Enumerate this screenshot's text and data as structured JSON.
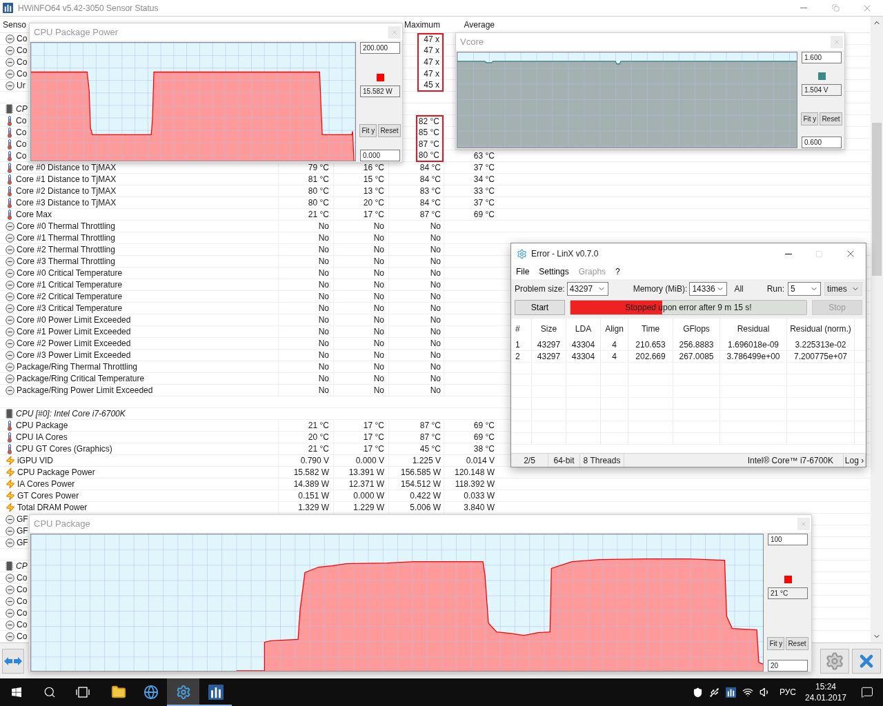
{
  "window": {
    "title": "HWiNFO64 v5.42-3050 Sensor Status"
  },
  "columns": {
    "sensor": "Senso",
    "maximum": "Maximum",
    "average": "Average"
  },
  "sections": [
    {
      "rows": [
        {
          "kind": "clock",
          "label": "Co",
          "maximum": "47 x",
          "boxed": true
        },
        {
          "kind": "clock",
          "label": "Co",
          "maximum": "47 x",
          "boxed": true
        },
        {
          "kind": "clock",
          "label": "Co",
          "maximum": "47 x",
          "boxed": true
        },
        {
          "kind": "clock",
          "label": "Co",
          "maximum": "47 x",
          "boxed": true
        },
        {
          "kind": "clock",
          "label": "Ur",
          "maximum": "45 x",
          "boxed": true
        }
      ]
    },
    {
      "header": "CP",
      "rows": [
        {
          "kind": "temperature",
          "label": "Co",
          "maximum": "82 °C",
          "boxed": true
        },
        {
          "kind": "temperature",
          "label": "Co",
          "maximum": "85 °C",
          "boxed": true
        },
        {
          "kind": "temperature",
          "label": "Co",
          "maximum": "87 °C",
          "boxed": true
        },
        {
          "kind": "temperature",
          "label": "Co",
          "maximum": "80 °C",
          "average": "63 °C",
          "boxed": true
        },
        {
          "kind": "temperature",
          "label": "Core #0 Distance to TjMAX",
          "current": "79 °C",
          "minimum": "16 °C",
          "maximum": "84 °C",
          "average": "37 °C",
          "boxed": false
        },
        {
          "kind": "temperature",
          "label": "Core #1 Distance to TjMAX",
          "current": "81 °C",
          "minimum": "15 °C",
          "maximum": "84 °C",
          "average": "34 °C",
          "boxed": false
        },
        {
          "kind": "temperature",
          "label": "Core #2 Distance to TjMAX",
          "current": "80 °C",
          "minimum": "13 °C",
          "maximum": "83 °C",
          "average": "33 °C",
          "boxed": false
        },
        {
          "kind": "temperature",
          "label": "Core #3 Distance to TjMAX",
          "current": "80 °C",
          "minimum": "20 °C",
          "maximum": "84 °C",
          "average": "37 °C",
          "boxed": false
        },
        {
          "kind": "temperature",
          "label": "Core Max",
          "current": "21 °C",
          "minimum": "17 °C",
          "maximum": "87 °C",
          "average": "69 °C",
          "boxed": false
        },
        {
          "kind": "clock",
          "label": "Core #0 Thermal Throttling",
          "current": "No",
          "minimum": "No",
          "maximum": "No",
          "boxed": false
        },
        {
          "kind": "clock",
          "label": "Core #1 Thermal Throttling",
          "current": "No",
          "minimum": "No",
          "maximum": "No",
          "boxed": false
        },
        {
          "kind": "clock",
          "label": "Core #2 Thermal Throttling",
          "current": "No",
          "minimum": "No",
          "maximum": "No",
          "boxed": false
        },
        {
          "kind": "clock",
          "label": "Core #3 Thermal Throttling",
          "current": "No",
          "minimum": "No",
          "maximum": "No",
          "boxed": false
        },
        {
          "kind": "clock",
          "label": "Core #0 Critical Temperature",
          "current": "No",
          "minimum": "No",
          "maximum": "No",
          "boxed": false
        },
        {
          "kind": "clock",
          "label": "Core #1 Critical Temperature",
          "current": "No",
          "minimum": "No",
          "maximum": "No",
          "boxed": false
        },
        {
          "kind": "clock",
          "label": "Core #2 Critical Temperature",
          "current": "No",
          "minimum": "No",
          "maximum": "No",
          "boxed": false
        },
        {
          "kind": "clock",
          "label": "Core #3 Critical Temperature",
          "current": "No",
          "minimum": "No",
          "maximum": "No",
          "boxed": false
        },
        {
          "kind": "clock",
          "label": "Core #0 Power Limit Exceeded",
          "current": "No",
          "minimum": "No",
          "maximum": "No",
          "boxed": false
        },
        {
          "kind": "clock",
          "label": "Core #1 Power Limit Exceeded",
          "current": "No",
          "minimum": "No",
          "maximum": "No",
          "boxed": false
        },
        {
          "kind": "clock",
          "label": "Core #2 Power Limit Exceeded",
          "current": "No",
          "minimum": "No",
          "maximum": "No",
          "boxed": false
        },
        {
          "kind": "clock",
          "label": "Core #3 Power Limit Exceeded",
          "current": "No",
          "minimum": "No",
          "maximum": "No",
          "boxed": false
        },
        {
          "kind": "clock",
          "label": "Package/Ring Thermal Throttling",
          "current": "No",
          "minimum": "No",
          "maximum": "No",
          "boxed": false
        },
        {
          "kind": "clock",
          "label": "Package/Ring Critical Temperature",
          "current": "No",
          "minimum": "No",
          "maximum": "No",
          "boxed": false
        },
        {
          "kind": "clock",
          "label": "Package/Ring Power Limit Exceeded",
          "current": "No",
          "minimum": "No",
          "maximum": "No",
          "boxed": false
        }
      ]
    },
    {
      "header": "CPU [#0]: Intel Core i7-6700K",
      "rows": [
        {
          "kind": "temperature",
          "label": "CPU Package",
          "current": "21 °C",
          "minimum": "17 °C",
          "maximum": "87 °C",
          "average": "69 °C",
          "boxed": false
        },
        {
          "kind": "temperature",
          "label": "CPU IA Cores",
          "current": "20 °C",
          "minimum": "17 °C",
          "maximum": "87 °C",
          "average": "69 °C",
          "boxed": false
        },
        {
          "kind": "temperature",
          "label": "CPU GT Cores (Graphics)",
          "current": "21 °C",
          "minimum": "17 °C",
          "maximum": "45 °C",
          "average": "38 °C",
          "boxed": false
        },
        {
          "kind": "power",
          "label": "iGPU VID",
          "current": "0.790 V",
          "minimum": "0.000 V",
          "maximum": "1.225 V",
          "average": "0.014 V",
          "boxed": false
        },
        {
          "kind": "power",
          "label": "CPU Package Power",
          "current": "15.582 W",
          "minimum": "13.391 W",
          "maximum": "156.585 W",
          "average": "120.148 W",
          "boxed": false
        },
        {
          "kind": "power",
          "label": "IA Cores Power",
          "current": "14.389 W",
          "minimum": "12.371 W",
          "maximum": "154.512 W",
          "average": "118.392 W",
          "boxed": false
        },
        {
          "kind": "power",
          "label": "GT Cores Power",
          "current": "0.151 W",
          "minimum": "0.000 W",
          "maximum": "0.422 W",
          "average": "0.033 W",
          "boxed": false
        },
        {
          "kind": "power",
          "label": "Total DRAM Power",
          "current": "1.329 W",
          "minimum": "1.229 W",
          "maximum": "5.006 W",
          "average": "3.840 W",
          "boxed": false
        },
        {
          "kind": "clock",
          "label": "GF"
        },
        {
          "kind": "clock",
          "label": "GF"
        },
        {
          "kind": "clock",
          "label": "GF"
        }
      ]
    },
    {
      "header": "CP",
      "rows": [
        {
          "kind": "clock",
          "label": "Co"
        },
        {
          "kind": "clock",
          "label": "Co"
        },
        {
          "kind": "clock",
          "label": "Co"
        },
        {
          "kind": "clock",
          "label": "Co"
        },
        {
          "kind": "clock",
          "label": "Co"
        },
        {
          "kind": "clock",
          "label": "Co"
        }
      ]
    }
  ],
  "graphs": [
    {
      "kind": "power",
      "title": "CPU Package Power",
      "top_value": "200.000",
      "current": "15.582 W",
      "bottom_value": "0.000",
      "color": "#ff0000",
      "buttons": [
        "Fit y",
        "Reset"
      ]
    },
    {
      "kind": "voltage",
      "title": "Vcore",
      "top_value": "1.600",
      "current": "1.504 V",
      "bottom_value": "0.600",
      "color": "#3a8a8a",
      "buttons": [
        "Fit y",
        "Reset"
      ]
    },
    {
      "kind": "temperature",
      "title": "CPU Package",
      "top_value": "100",
      "current": "21 °C",
      "bottom_value": "20",
      "color": "#ff0000",
      "buttons": [
        "Fit y",
        "Reset"
      ]
    }
  ],
  "linx": {
    "title": "Error - LinX v0.7.0",
    "menu": [
      {
        "label": "File",
        "disabled": false
      },
      {
        "label": "Settings",
        "disabled": false
      },
      {
        "label": "Graphs",
        "disabled": true
      },
      {
        "label": "?",
        "disabled": false
      }
    ],
    "problem_size": {
      "label": "Problem size:",
      "value": "43297"
    },
    "memory": {
      "label": "Memory (MiB):",
      "value": "14336"
    },
    "all": "All",
    "run": {
      "label": "Run:",
      "value": "5",
      "unit": "times"
    },
    "start": {
      "label": "Start",
      "disabled": false
    },
    "stop": {
      "label": "Stop",
      "disabled": true
    },
    "progress": {
      "text": "Stopped upon error after 9 m 15 s!",
      "level": 0.39
    },
    "columns": [
      "#",
      "Size",
      "LDA",
      "Align",
      "Time",
      "GFlops",
      "Residual",
      "Residual (norm.)"
    ],
    "rows": [
      [
        "1",
        "43297",
        "43304",
        "4",
        "210.653",
        "256.8883",
        "1.696018e-09",
        "3.225313e-02"
      ],
      [
        "2",
        "43297",
        "43304",
        "4",
        "202.669",
        "267.0085",
        "3.786499e+00",
        "7.200775e+07"
      ]
    ],
    "status_bar": [
      "2/5",
      "64-bit",
      "8 Threads",
      "Intel® Core™ i7-6700K",
      "Log ›"
    ]
  },
  "taskbar": {
    "apps": [
      {
        "selected": false,
        "running": false
      },
      {
        "selected": false,
        "running": false
      },
      {
        "selected": true,
        "running": true
      },
      {
        "selected": false,
        "running": true
      }
    ],
    "language": "РУС",
    "time": "15:24",
    "date": "24.01.2017"
  }
}
